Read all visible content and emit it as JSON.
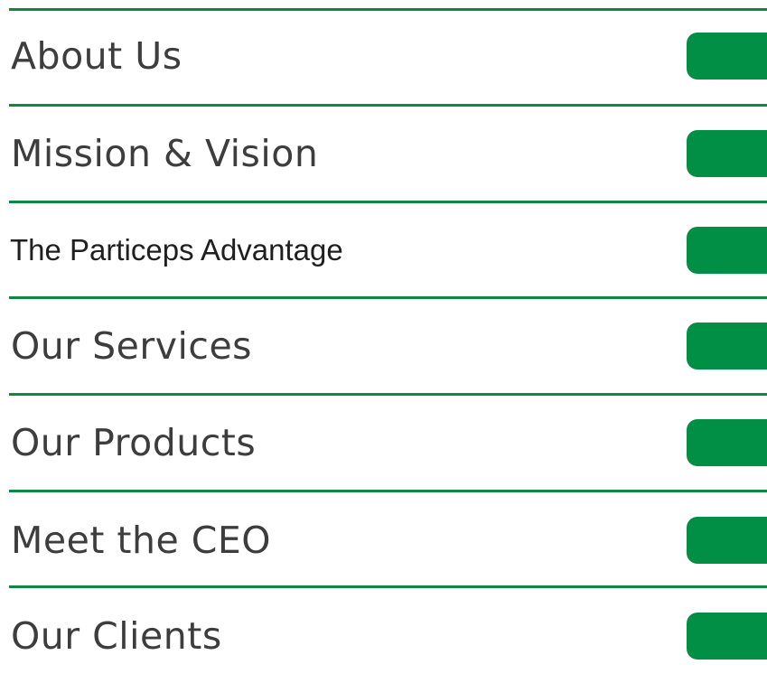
{
  "menu": {
    "accent_color": "#008f45",
    "divider_color": "#0b8a3f",
    "items": [
      {
        "label": "About Us"
      },
      {
        "label": "Mission & Vision"
      },
      {
        "label": "The Particeps Advantage"
      },
      {
        "label": "Our Services"
      },
      {
        "label": "Our Products"
      },
      {
        "label": "Meet the CEO"
      },
      {
        "label": "Our Clients"
      }
    ]
  }
}
